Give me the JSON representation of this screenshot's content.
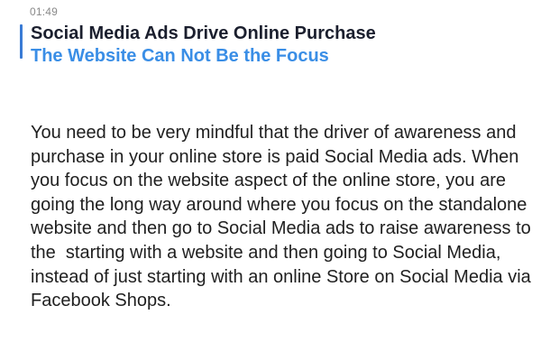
{
  "header": {
    "timestamp": "01:49",
    "title": "Social Media Ads Drive Online Purchase",
    "subtitle": "The Website Can Not Be the Focus"
  },
  "content": {
    "paragraph": "You need to be very mindful that the driver of awareness and purchase in your online store is paid Social Media ads. When you focus on the website aspect of the online store, you are going the long way around where you focus on the standalone website and then go to Social Media ads to raise awareness to the  starting with a website and then going to Social Media, instead of just starting with an online Store on Social Media via Facebook Shops."
  },
  "colors": {
    "accent_bar": "#3a7bd5",
    "title": "#1b1f2e",
    "subtitle": "#3a8ee6",
    "timestamp": "#8a8a8a",
    "body": "#1f1f1f",
    "background": "#ffffff"
  }
}
